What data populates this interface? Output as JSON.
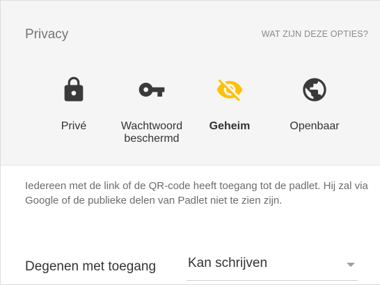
{
  "header": {
    "title": "Privacy",
    "help_link": "WAT ZIJN DEZE OPTIES?"
  },
  "privacy_options": [
    {
      "id": "prive",
      "label": "Privé",
      "icon": "lock-icon",
      "selected": false
    },
    {
      "id": "wachtwoord",
      "label_line1": "Wachtwoord",
      "label_line2": "beschermd",
      "icon": "key-icon",
      "selected": false
    },
    {
      "id": "geheim",
      "label": "Geheim",
      "icon": "eye-off-icon",
      "selected": true
    },
    {
      "id": "openbaar",
      "label": "Openbaar",
      "icon": "globe-icon",
      "selected": false
    }
  ],
  "description": "Iedereen met de link of de QR-code heeft toegang tot de padlet. Hij zal via Google of de publieke delen van Padlet niet te zien zijn.",
  "access": {
    "label": "Degenen met toegang",
    "selected_value": "Kan schrijven"
  },
  "colors": {
    "header_bg": "#f5f5f5",
    "icon_default": "#3a3a3a",
    "icon_selected": "#ffc107",
    "muted_text": "#757575"
  }
}
